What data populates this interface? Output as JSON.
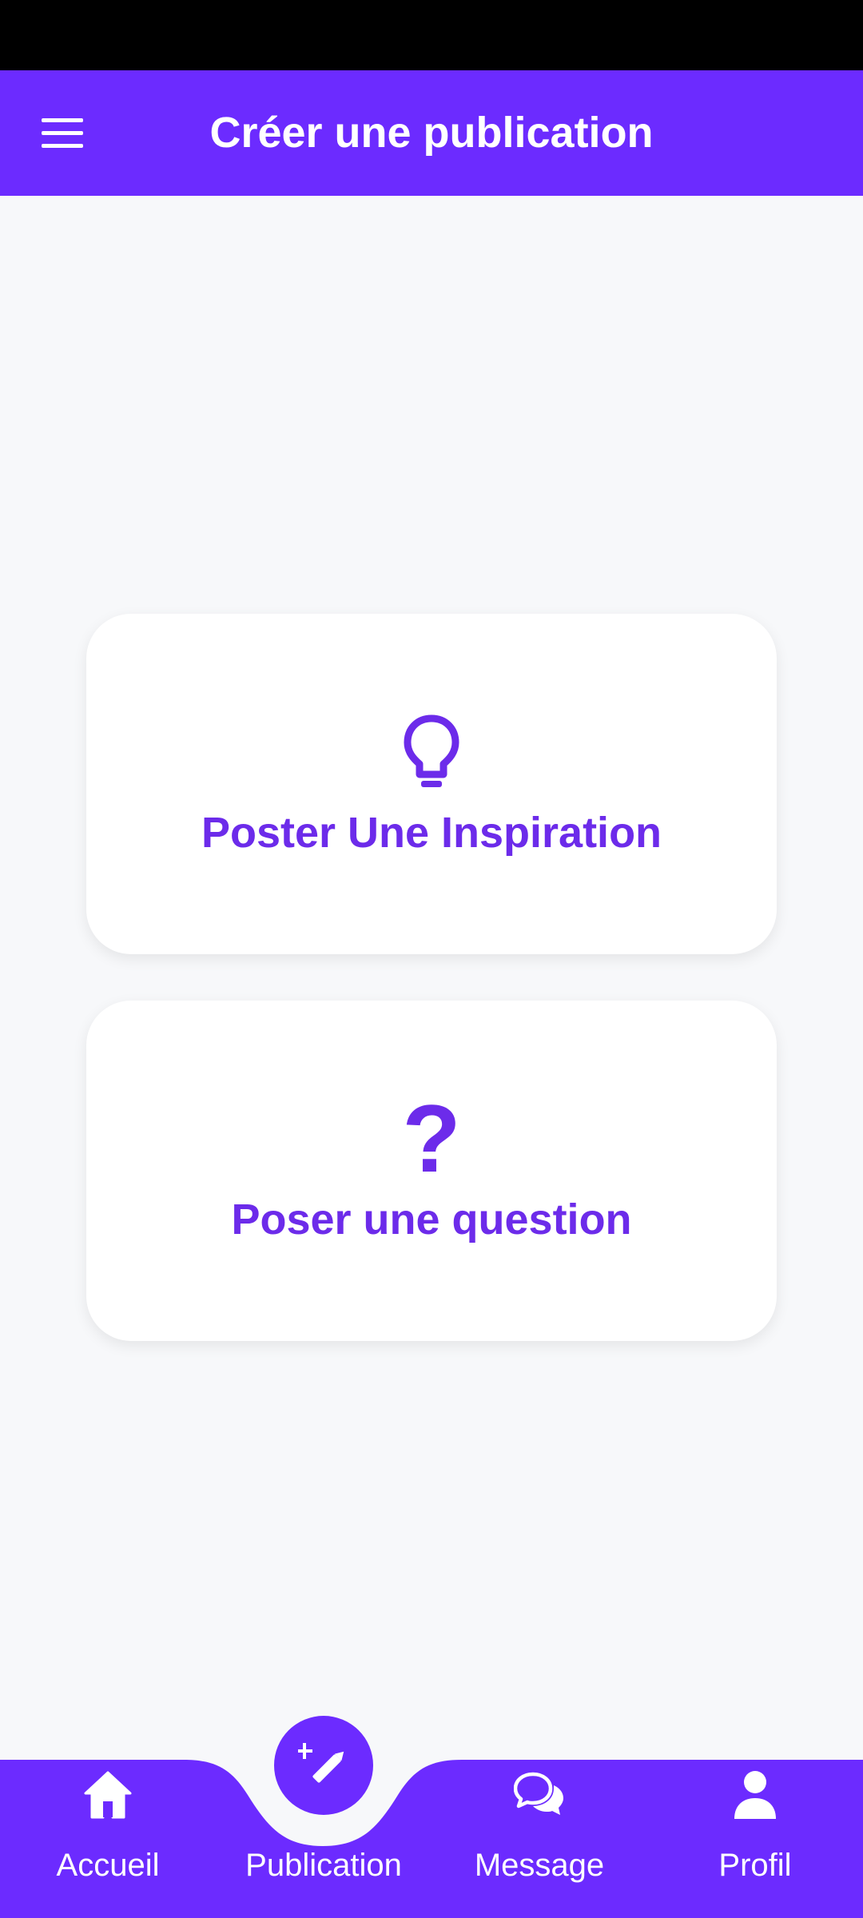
{
  "app_bar": {
    "title": "Créer une publication",
    "menu_icon": "hamburger-menu-icon",
    "color": "#6C2BFF"
  },
  "cards": [
    {
      "icon": "lightbulb-icon",
      "label": "Poster Une Inspiration"
    },
    {
      "icon": "question-mark-icon",
      "glyph": "?",
      "label": "Poser une question"
    }
  ],
  "bottom_nav": {
    "items": [
      {
        "icon": "home-icon",
        "label": "Accueil"
      },
      {
        "icon": "magic-pencil-icon",
        "label": "Publication",
        "active": true
      },
      {
        "icon": "chat-bubbles-icon",
        "label": "Message"
      },
      {
        "icon": "person-icon",
        "label": "Profil"
      }
    ],
    "color": "#6C2BFF"
  },
  "colors": {
    "accent": "#6C2BFF",
    "card_text": "#6C2BEA",
    "background": "#F7F8FA"
  }
}
